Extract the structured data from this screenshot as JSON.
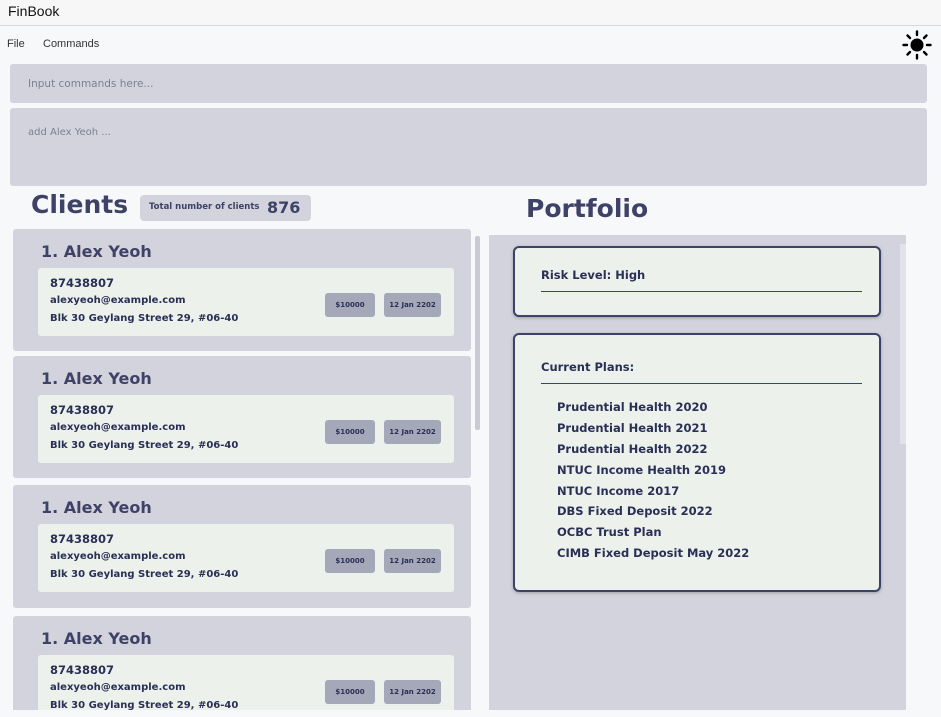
{
  "app": {
    "title": "FinBook"
  },
  "menu": {
    "file": "File",
    "commands": "Commands",
    "theme_icon": "sun-icon"
  },
  "command": {
    "placeholder": "Input commands here...",
    "result_text": "add Alex Yeoh ..."
  },
  "clients": {
    "title": "Clients",
    "total_label": "Total number of clients",
    "total_count": "876",
    "items": [
      {
        "name": "1. Alex Yeoh",
        "phone": "87438807",
        "email": "alexyeoh@example.com",
        "address": "Blk 30 Geylang Street 29, #06-40",
        "amount": "$10000",
        "date": "12 Jan 2202"
      },
      {
        "name": "1. Alex Yeoh",
        "phone": "87438807",
        "email": "alexyeoh@example.com",
        "address": "Blk 30 Geylang Street 29, #06-40",
        "amount": "$10000",
        "date": "12 Jan 2202"
      },
      {
        "name": "1. Alex Yeoh",
        "phone": "87438807",
        "email": "alexyeoh@example.com",
        "address": "Blk 30 Geylang Street 29, #06-40",
        "amount": "$10000",
        "date": "12 Jan 2202"
      },
      {
        "name": "1. Alex Yeoh",
        "phone": "87438807",
        "email": "alexyeoh@example.com",
        "address": "Blk 30 Geylang Street 29, #06-40",
        "amount": "$10000",
        "date": "12 Jan 2202"
      }
    ]
  },
  "portfolio": {
    "title": "Portfolio",
    "risk_level": "Risk Level: High",
    "plans_heading": "Current Plans:",
    "plans": [
      "Prudential Health 2020",
      "Prudential Health 2021",
      "Prudential Health 2022",
      "NTUC Income Health 2019",
      "NTUC Income 2017",
      "DBS Fixed Deposit 2022",
      "OCBC Trust Plan",
      "CIMB Fixed Deposit May 2022"
    ]
  }
}
